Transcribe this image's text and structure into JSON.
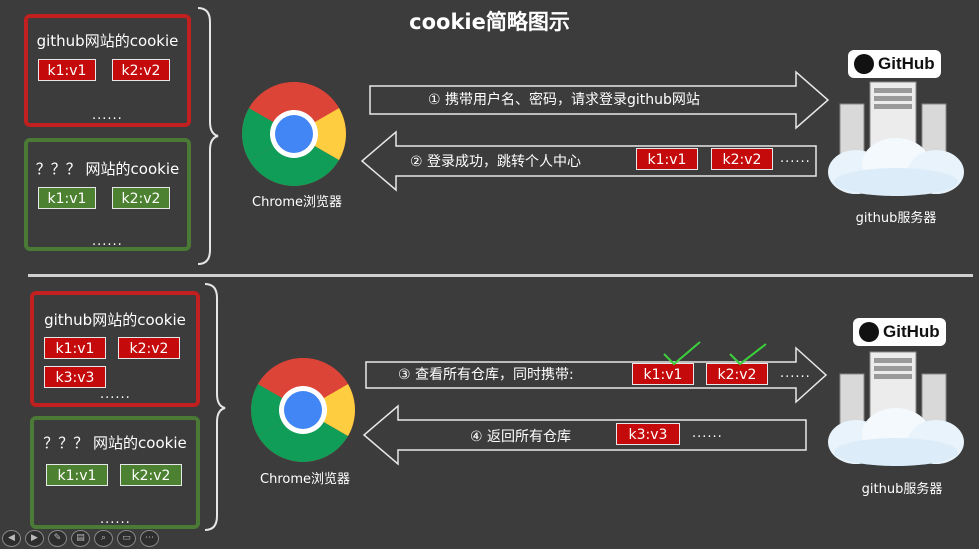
{
  "title": "cookie简略图示",
  "top": {
    "github_box": {
      "title": "github网站的cookie",
      "items": [
        "k1:v1",
        "k2:v2"
      ],
      "ellipsis": "......"
    },
    "unknown_box": {
      "title": "？？？ 网站的cookie",
      "items": [
        "k1:v1",
        "k2:v2"
      ],
      "ellipsis": "......"
    },
    "browser_label": "Chrome浏览器",
    "arrow1_label": "① 携带用户名、密码，请求登录github网站",
    "arrow2_label": "② 登录成功，跳转个人中心",
    "arrow2_items": [
      "k1:v1",
      "k2:v2"
    ],
    "arrow2_ellipsis": "......",
    "github_badge": "GitHub",
    "server_label": "github服务器"
  },
  "bottom": {
    "github_box": {
      "title": "github网站的cookie",
      "items": [
        "k1:v1",
        "k2:v2",
        "k3:v3"
      ],
      "ellipsis": "......"
    },
    "unknown_box": {
      "title": "？？？ 网站的cookie",
      "items": [
        "k1:v1",
        "k2:v2"
      ],
      "ellipsis": "......"
    },
    "browser_label": "Chrome浏览器",
    "arrow3_label": "③ 查看所有仓库，同时携带:",
    "arrow3_items": [
      "k1:v1",
      "k2:v2"
    ],
    "arrow3_ellipsis": "......",
    "arrow4_label": "④ 返回所有仓库",
    "arrow4_items": [
      "k3:v3"
    ],
    "arrow4_ellipsis": "......",
    "github_badge": "GitHub",
    "server_label": "github服务器"
  },
  "colors": {
    "background": "#3c3c3c",
    "red": "#c0201f",
    "green": "#4b7a36",
    "check": "#3bd13b"
  },
  "toolbar_icons": [
    "prev-icon",
    "next-icon",
    "pen-icon",
    "pages-icon",
    "zoom-icon",
    "screen-icon",
    "more-icon"
  ]
}
